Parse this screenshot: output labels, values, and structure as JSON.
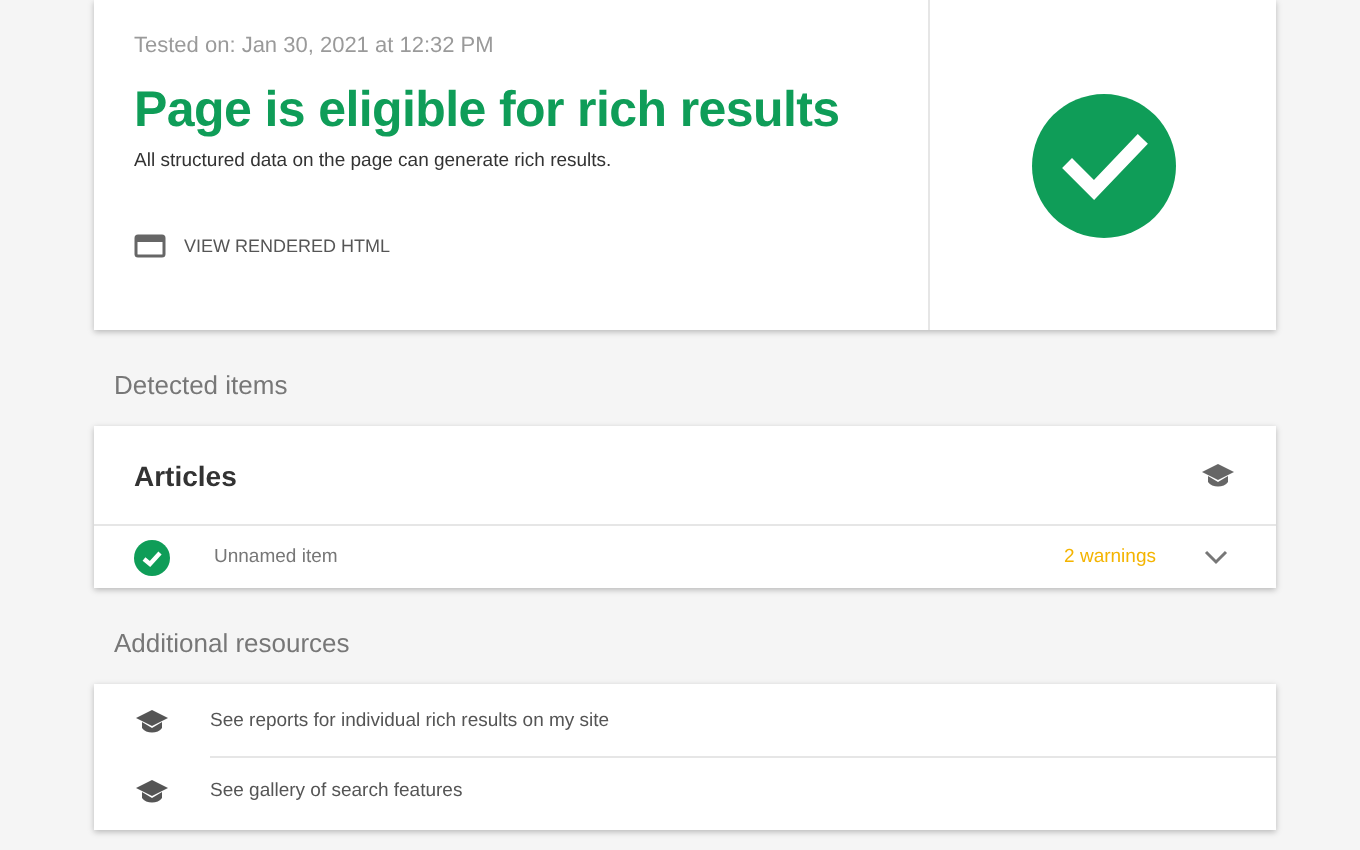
{
  "result": {
    "tested_on": "Tested on: Jan 30, 2021 at 12:32 PM",
    "title": "Page is eligible for rich results",
    "description": "All structured data on the page can generate rich results.",
    "action": "VIEW RENDERED HTML",
    "valid": true
  },
  "detected": {
    "heading": "Detected items",
    "groups": [
      {
        "title": "Articles",
        "items": [
          {
            "label": "Unnamed item",
            "valid": true,
            "warnings": "2 warnings",
            "expanded": false
          }
        ]
      }
    ]
  },
  "resources": {
    "heading": "Additional resources",
    "links": [
      "See reports for individual rich results on my site",
      "See gallery of search features"
    ]
  }
}
